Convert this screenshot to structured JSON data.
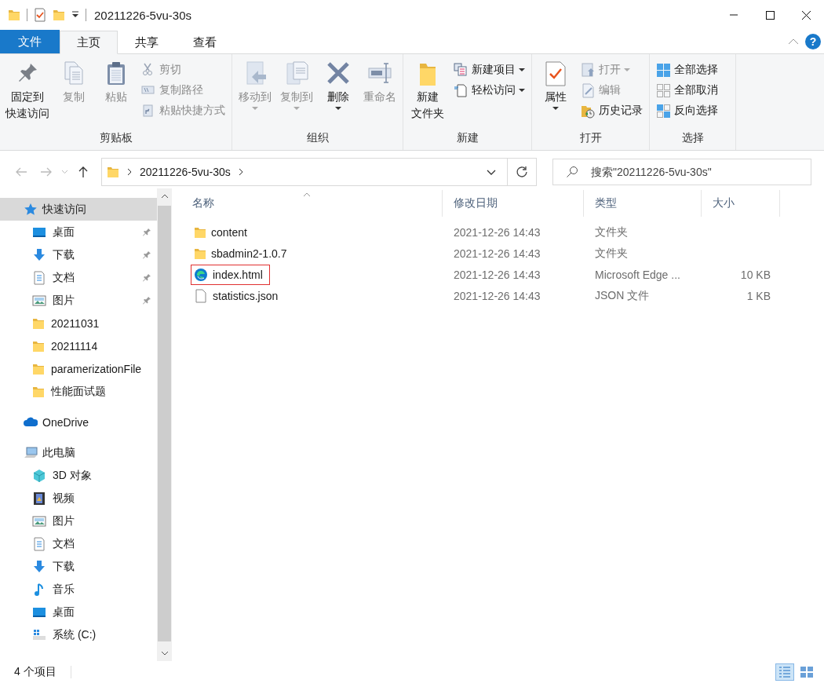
{
  "window": {
    "title": "20211226-5vu-30s"
  },
  "tabs": [
    {
      "label": "文件",
      "kind": "file",
      "selected": false
    },
    {
      "label": "主页",
      "kind": "tab",
      "selected": true
    },
    {
      "label": "共享",
      "kind": "tab",
      "selected": false
    },
    {
      "label": "查看",
      "kind": "tab",
      "selected": false
    }
  ],
  "help_button": {
    "label": "?"
  },
  "ribbon": [
    {
      "label": "剪贴板",
      "items": [
        {
          "kind": "large",
          "label_lines": [
            "固定到",
            "快速访问"
          ],
          "disabled": false,
          "dropdown": false
        },
        {
          "kind": "large",
          "label": "复制",
          "disabled": true,
          "dropdown": false
        },
        {
          "kind": "large",
          "label": "粘贴",
          "disabled": true,
          "dropdown": false
        },
        {
          "kind": "small",
          "label": "剪切",
          "disabled": true,
          "dropdown": false
        },
        {
          "kind": "small",
          "label": "复制路径",
          "disabled": true,
          "dropdown": false
        },
        {
          "kind": "small",
          "label": "粘贴快捷方式",
          "disabled": true,
          "dropdown": false
        }
      ]
    },
    {
      "label": "组织",
      "items": [
        {
          "kind": "large",
          "label": "移动到",
          "disabled": true,
          "dropdown": true
        },
        {
          "kind": "large",
          "label": "复制到",
          "disabled": true,
          "dropdown": true
        },
        {
          "kind": "large",
          "label": "删除",
          "disabled": false,
          "dropdown": true
        },
        {
          "kind": "large",
          "label": "重命名",
          "disabled": true,
          "dropdown": false
        }
      ]
    },
    {
      "label": "新建",
      "items": [
        {
          "kind": "large",
          "label_lines": [
            "新建",
            "文件夹"
          ],
          "disabled": false,
          "dropdown": false
        },
        {
          "kind": "small",
          "label": "新建项目",
          "disabled": false,
          "dropdown": true
        },
        {
          "kind": "small",
          "label": "轻松访问",
          "disabled": false,
          "dropdown": true
        }
      ]
    },
    {
      "label": "打开",
      "items": [
        {
          "kind": "large",
          "label": "属性",
          "disabled": false,
          "dropdown": true
        },
        {
          "kind": "small",
          "label": "打开",
          "disabled": true,
          "dropdown": true
        },
        {
          "kind": "small",
          "label": "编辑",
          "disabled": true,
          "dropdown": false
        },
        {
          "kind": "small",
          "label": "历史记录",
          "disabled": false,
          "dropdown": false
        }
      ]
    },
    {
      "label": "选择",
      "items": [
        {
          "kind": "small",
          "label": "全部选择",
          "disabled": false,
          "dropdown": false
        },
        {
          "kind": "small",
          "label": "全部取消",
          "disabled": false,
          "dropdown": false
        },
        {
          "kind": "small",
          "label": "反向选择",
          "disabled": false,
          "dropdown": false
        }
      ]
    }
  ],
  "address_bar": {
    "path": "20211226-5vu-30s"
  },
  "search": {
    "placeholder": "搜索\"20211226-5vu-30s\""
  },
  "sidebar": {
    "items": [
      {
        "name": "快速访问",
        "selected": true,
        "children": [
          {
            "name": "桌面",
            "selected": false,
            "pinned": true
          },
          {
            "name": "下载",
            "selected": false,
            "pinned": true
          },
          {
            "name": "文档",
            "selected": false,
            "pinned": true
          },
          {
            "name": "图片",
            "selected": false,
            "pinned": true
          },
          {
            "name": "20211031",
            "selected": false,
            "pinned": false
          },
          {
            "name": "20211114",
            "selected": false,
            "pinned": false
          },
          {
            "name": "paramerizationFile",
            "selected": false,
            "pinned": false
          },
          {
            "name": "性能面试题",
            "selected": false,
            "pinned": false
          }
        ]
      },
      {
        "name": "OneDrive",
        "selected": false
      },
      {
        "name": "此电脑",
        "selected": false,
        "children": [
          {
            "name": "3D 对象",
            "selected": false
          },
          {
            "name": "视频",
            "selected": false
          },
          {
            "name": "图片",
            "selected": false
          },
          {
            "name": "文档",
            "selected": false
          },
          {
            "name": "下载",
            "selected": false
          },
          {
            "name": "音乐",
            "selected": false
          },
          {
            "name": "桌面",
            "selected": false
          },
          {
            "name": "系统 (C:)",
            "selected": false
          }
        ]
      }
    ]
  },
  "table": {
    "columns": [
      "名称",
      "修改日期",
      "类型",
      "大小"
    ],
    "rows": [
      {
        "kind": "folder",
        "name": "content",
        "modified": "2021-12-26 14:43",
        "type": "文件夹",
        "highlighted": false
      },
      {
        "kind": "folder",
        "name": "sbadmin2-1.0.7",
        "modified": "2021-12-26 14:43",
        "type": "文件夹",
        "highlighted": false
      },
      {
        "kind": "edge",
        "name": "index.html",
        "modified": "2021-12-26 14:43",
        "type": "Microsoft Edge ...",
        "size": "10 KB",
        "highlighted": true
      },
      {
        "kind": "file",
        "name": "statistics.json",
        "modified": "2021-12-26 14:43",
        "type": "JSON 文件",
        "size": "1 KB",
        "highlighted": false
      }
    ]
  },
  "status_bar": {
    "text": "4 个项目",
    "views": [
      {
        "kind": "details",
        "selected": true
      },
      {
        "kind": "tiles",
        "selected": false
      }
    ]
  }
}
